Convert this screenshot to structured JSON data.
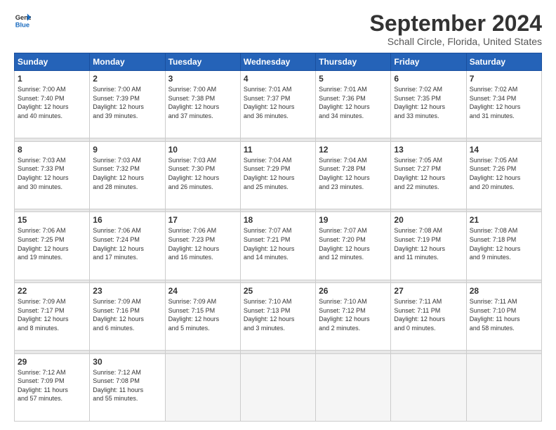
{
  "logo": {
    "line1": "General",
    "line2": "Blue"
  },
  "title": "September 2024",
  "location": "Schall Circle, Florida, United States",
  "headers": [
    "Sunday",
    "Monday",
    "Tuesday",
    "Wednesday",
    "Thursday",
    "Friday",
    "Saturday"
  ],
  "weeks": [
    [
      {
        "day": "1",
        "info": "Sunrise: 7:00 AM\nSunset: 7:40 PM\nDaylight: 12 hours\nand 40 minutes."
      },
      {
        "day": "2",
        "info": "Sunrise: 7:00 AM\nSunset: 7:39 PM\nDaylight: 12 hours\nand 39 minutes."
      },
      {
        "day": "3",
        "info": "Sunrise: 7:00 AM\nSunset: 7:38 PM\nDaylight: 12 hours\nand 37 minutes."
      },
      {
        "day": "4",
        "info": "Sunrise: 7:01 AM\nSunset: 7:37 PM\nDaylight: 12 hours\nand 36 minutes."
      },
      {
        "day": "5",
        "info": "Sunrise: 7:01 AM\nSunset: 7:36 PM\nDaylight: 12 hours\nand 34 minutes."
      },
      {
        "day": "6",
        "info": "Sunrise: 7:02 AM\nSunset: 7:35 PM\nDaylight: 12 hours\nand 33 minutes."
      },
      {
        "day": "7",
        "info": "Sunrise: 7:02 AM\nSunset: 7:34 PM\nDaylight: 12 hours\nand 31 minutes."
      }
    ],
    [
      {
        "day": "8",
        "info": "Sunrise: 7:03 AM\nSunset: 7:33 PM\nDaylight: 12 hours\nand 30 minutes."
      },
      {
        "day": "9",
        "info": "Sunrise: 7:03 AM\nSunset: 7:32 PM\nDaylight: 12 hours\nand 28 minutes."
      },
      {
        "day": "10",
        "info": "Sunrise: 7:03 AM\nSunset: 7:30 PM\nDaylight: 12 hours\nand 26 minutes."
      },
      {
        "day": "11",
        "info": "Sunrise: 7:04 AM\nSunset: 7:29 PM\nDaylight: 12 hours\nand 25 minutes."
      },
      {
        "day": "12",
        "info": "Sunrise: 7:04 AM\nSunset: 7:28 PM\nDaylight: 12 hours\nand 23 minutes."
      },
      {
        "day": "13",
        "info": "Sunrise: 7:05 AM\nSunset: 7:27 PM\nDaylight: 12 hours\nand 22 minutes."
      },
      {
        "day": "14",
        "info": "Sunrise: 7:05 AM\nSunset: 7:26 PM\nDaylight: 12 hours\nand 20 minutes."
      }
    ],
    [
      {
        "day": "15",
        "info": "Sunrise: 7:06 AM\nSunset: 7:25 PM\nDaylight: 12 hours\nand 19 minutes."
      },
      {
        "day": "16",
        "info": "Sunrise: 7:06 AM\nSunset: 7:24 PM\nDaylight: 12 hours\nand 17 minutes."
      },
      {
        "day": "17",
        "info": "Sunrise: 7:06 AM\nSunset: 7:23 PM\nDaylight: 12 hours\nand 16 minutes."
      },
      {
        "day": "18",
        "info": "Sunrise: 7:07 AM\nSunset: 7:21 PM\nDaylight: 12 hours\nand 14 minutes."
      },
      {
        "day": "19",
        "info": "Sunrise: 7:07 AM\nSunset: 7:20 PM\nDaylight: 12 hours\nand 12 minutes."
      },
      {
        "day": "20",
        "info": "Sunrise: 7:08 AM\nSunset: 7:19 PM\nDaylight: 12 hours\nand 11 minutes."
      },
      {
        "day": "21",
        "info": "Sunrise: 7:08 AM\nSunset: 7:18 PM\nDaylight: 12 hours\nand 9 minutes."
      }
    ],
    [
      {
        "day": "22",
        "info": "Sunrise: 7:09 AM\nSunset: 7:17 PM\nDaylight: 12 hours\nand 8 minutes."
      },
      {
        "day": "23",
        "info": "Sunrise: 7:09 AM\nSunset: 7:16 PM\nDaylight: 12 hours\nand 6 minutes."
      },
      {
        "day": "24",
        "info": "Sunrise: 7:09 AM\nSunset: 7:15 PM\nDaylight: 12 hours\nand 5 minutes."
      },
      {
        "day": "25",
        "info": "Sunrise: 7:10 AM\nSunset: 7:13 PM\nDaylight: 12 hours\nand 3 minutes."
      },
      {
        "day": "26",
        "info": "Sunrise: 7:10 AM\nSunset: 7:12 PM\nDaylight: 12 hours\nand 2 minutes."
      },
      {
        "day": "27",
        "info": "Sunrise: 7:11 AM\nSunset: 7:11 PM\nDaylight: 12 hours\nand 0 minutes."
      },
      {
        "day": "28",
        "info": "Sunrise: 7:11 AM\nSunset: 7:10 PM\nDaylight: 11 hours\nand 58 minutes."
      }
    ],
    [
      {
        "day": "29",
        "info": "Sunrise: 7:12 AM\nSunset: 7:09 PM\nDaylight: 11 hours\nand 57 minutes."
      },
      {
        "day": "30",
        "info": "Sunrise: 7:12 AM\nSunset: 7:08 PM\nDaylight: 11 hours\nand 55 minutes."
      },
      {
        "day": "",
        "info": ""
      },
      {
        "day": "",
        "info": ""
      },
      {
        "day": "",
        "info": ""
      },
      {
        "day": "",
        "info": ""
      },
      {
        "day": "",
        "info": ""
      }
    ]
  ]
}
